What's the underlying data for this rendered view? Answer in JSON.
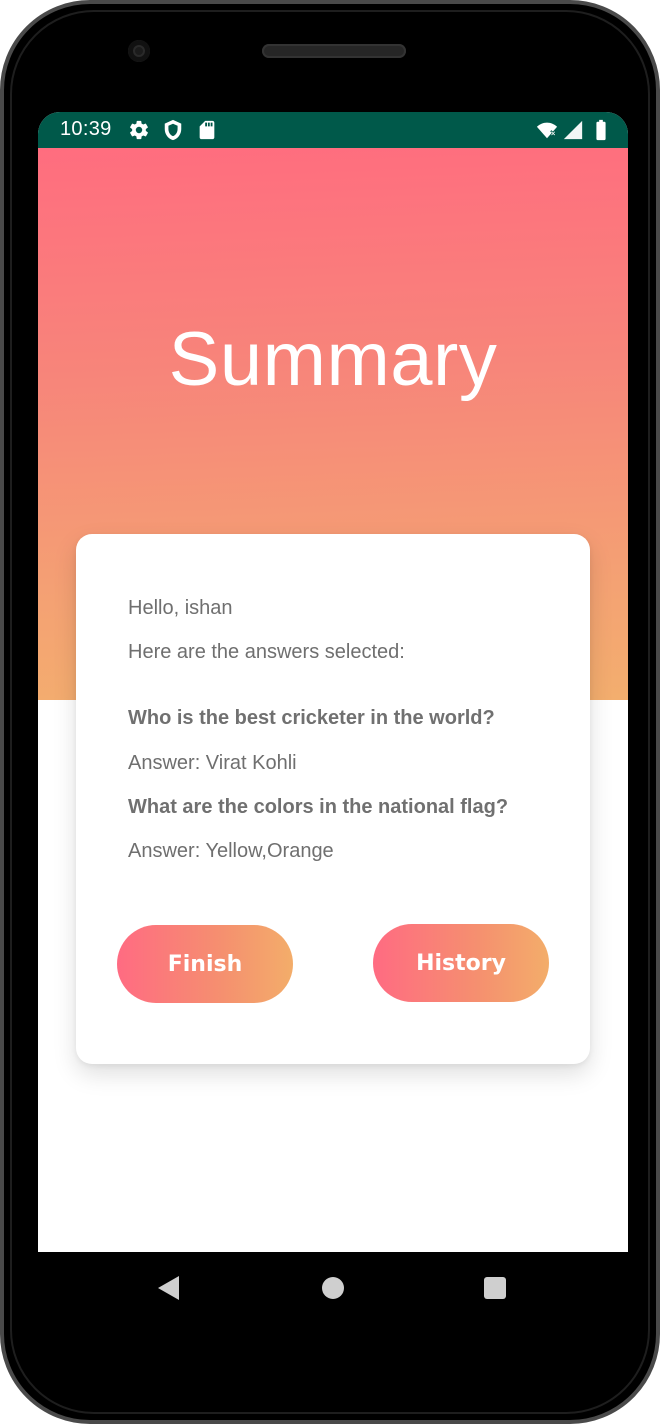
{
  "status_bar": {
    "time": "10:39",
    "left_icons": [
      "gear-icon",
      "shield-icon",
      "sd-card-icon"
    ],
    "right_icons": [
      "wifi-icon",
      "signal-icon",
      "battery-icon"
    ],
    "background_color": "#00594a"
  },
  "header": {
    "title": "Summary",
    "gradient_colors": [
      "#ff6d7f",
      "#f3ae6e"
    ]
  },
  "summary_card": {
    "greeting": "Hello, ishan",
    "intro": "Here are the answers selected:",
    "questions": [
      {
        "question": "Who is the best cricketer in the world?",
        "answer": "Answer: Virat Kohli"
      },
      {
        "question": "What are the colors in the national flag?",
        "answer": "Answer: Yellow,Orange"
      }
    ],
    "buttons": {
      "finish_label": "Finish",
      "history_label": "History"
    }
  },
  "nav_bar": {
    "icons": [
      "back-icon",
      "home-icon",
      "recents-icon"
    ]
  }
}
